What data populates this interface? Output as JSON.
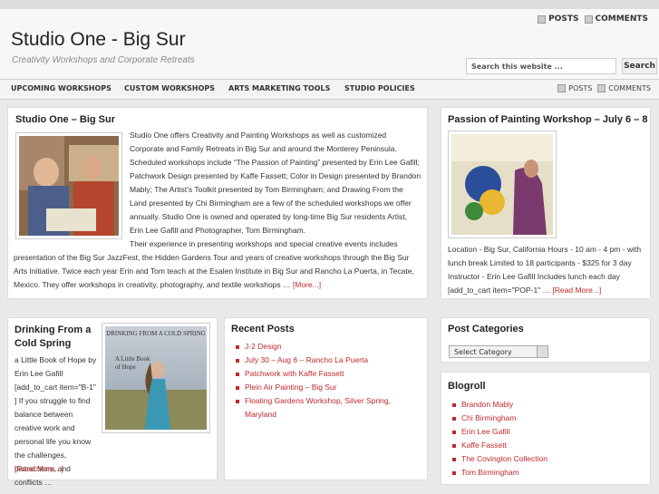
{
  "header": {
    "site_title": "Studio One - Big Sur",
    "site_description": "Creativity Workshops and Corporate Retreats",
    "top_links": [
      "POSTS",
      "COMMENTS"
    ],
    "search_placeholder": "Search this website ...",
    "search_button": "Search"
  },
  "nav": {
    "items": [
      "UPCOMING WORKSHOPS",
      "CUSTOM WORKSHOPS",
      "ARTS MARKETING TOOLS",
      "STUDIO POLICIES"
    ],
    "feeds": [
      "POSTS",
      "COMMENTS"
    ]
  },
  "main_post": {
    "title": "Studio One – Big Sur",
    "intro": "Studio One offers Creativity and Painting Workshops as well as customized Corporate and Family Retreats in Big Sur and around the Monterey Peninsula. Scheduled workshops include “The Passion of Painting” presented by Erin Lee Gafill; Patchwork Design presented by Kaffe Fassett; Color in Design presented by Brandon Mably; The Artist’s Toolkit presented by Tom Birmingham; and Drawing From the Land presented by Chi Birmingham are a few of the scheduled workshops we offer annually. Studio One is owned and operated by long-time Big Sur residents Artist, Erin Lee Gafill and Photographer, Tom Birmingham.",
    "continued": "Their experience in presenting workshops and special creative events includes presentation of the Big Sur JazzFest, the Hidden Gardens Tour and years of creative workshops through the Big Sur Arts Initiative. Twice each year Erin and Tom teach at the Esalen Institute in Big Sur and Rancho La Puerta, in Tecate, Mexico. They offer workshops in creativity, photography, and textile workshops …",
    "read_more": "[More...]"
  },
  "passion_post": {
    "title": "Passion of Painting Workshop – July 6 – 8",
    "text": "Location - Big Sur, California Hours - 10 am - 4 pm - with lunch break Limited to 18 participants - $325 for 3 day Instructor - Erin Lee Gafill Includes lunch each day [add_to_cart item=\"POP-1\" …",
    "read_more": "[Read More...]"
  },
  "book_post": {
    "title": "Drinking From a Cold Spring",
    "text": "a Little Book of Hope by Erin Lee Gafill [add_to_cart item=\"B-1\" ] If you struggle to find balance between creative work and personal life you know the challenges, distractions, and conflicts …",
    "read_more": "[Read More...]",
    "cover_title": "DRINKING FROM A COLD SPRING",
    "cover_sub": "A Little Book of Hope"
  },
  "recent_posts": {
    "title": "Recent Posts",
    "items": [
      "J-2 Design",
      "July 30 – Aug 6 – Rancho La Puerta",
      "Patchwork with Kaffe Fassett",
      "Plein Air Painting – Big Sur",
      "Floating Gardens Workshop, Silver Spring, Maryland"
    ]
  },
  "categories": {
    "title": "Post Categories",
    "select_value": "Select Category"
  },
  "blogroll": {
    "title": "Blogroll",
    "items": [
      "Brandon Mably",
      "Chi Birmingham",
      "Erin Lee Gafill",
      "Kaffe Fassett",
      "The Covington Collection",
      "Tom Birmingham"
    ]
  },
  "colors": {
    "link": "#c0282d",
    "background": "#e9e9e9"
  }
}
